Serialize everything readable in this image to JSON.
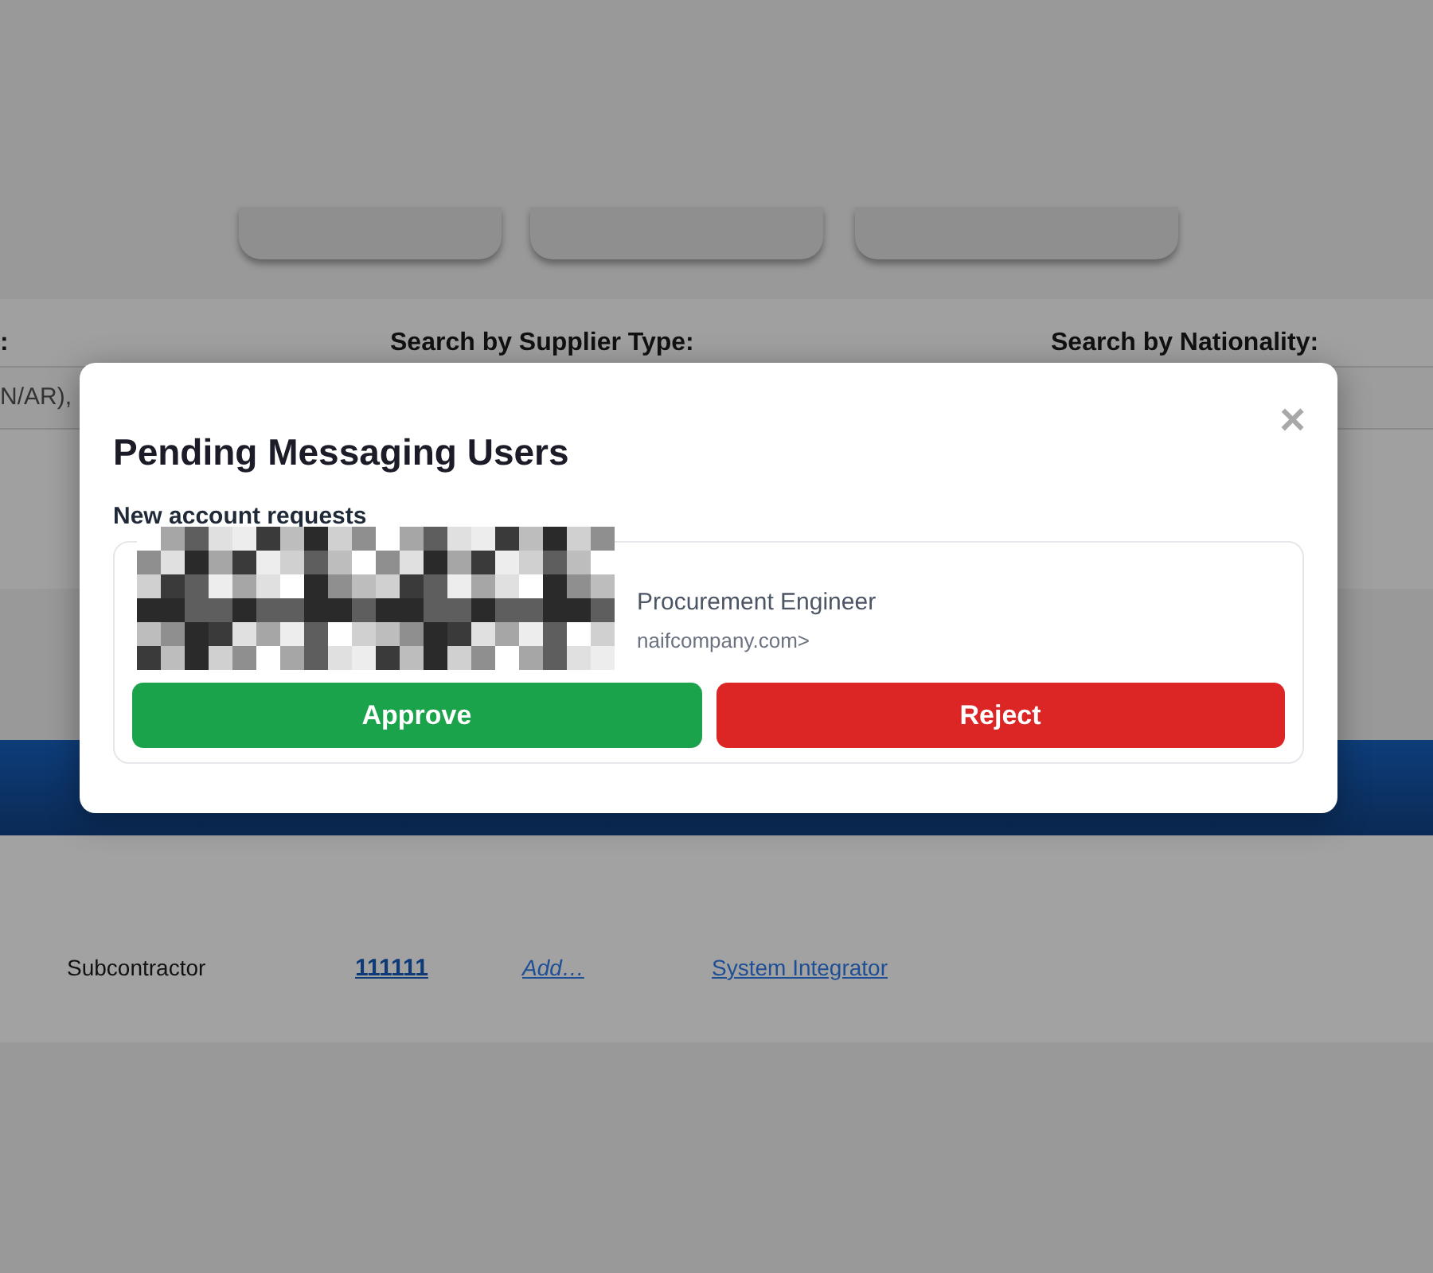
{
  "page": {
    "filters": [
      {
        "label": ":"
      },
      {
        "label": "Search by Supplier Type:"
      },
      {
        "label": "Search by Nationality:"
      }
    ],
    "search_value": "N/AR),",
    "row": {
      "type": "Subcontractor",
      "code": "111111",
      "add_link": "Add…",
      "category": "System Integrator"
    }
  },
  "modal": {
    "title": "Pending Messaging Users",
    "close": "×",
    "section": "New account requests",
    "requests": [
      {
        "title_line": "Procurement Engineer",
        "email_line": "naifcompany.com>",
        "approve": "Approve",
        "reject": "Reject"
      }
    ]
  }
}
